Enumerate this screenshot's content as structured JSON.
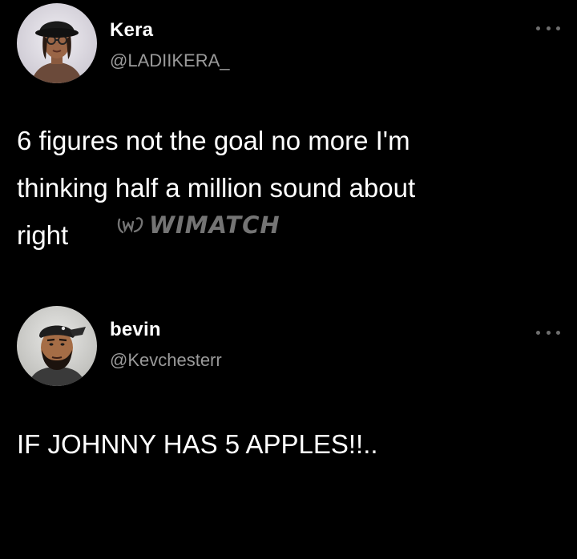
{
  "tweets": [
    {
      "display_name": "Kera",
      "handle": "@LADIIKERA_",
      "text": "6 figures not the goal no more I'm\nthinking half a million sound about\nright",
      "avatar_icon": "person-with-hat-avatar",
      "more_icon": "more-options-icon"
    },
    {
      "display_name": "bevin",
      "handle": "@Kevchesterr",
      "text": "IF JOHNNY HAS 5 APPLES!!..",
      "avatar_icon": "bearded-man-with-cap-avatar",
      "more_icon": "more-options-icon"
    }
  ],
  "watermark": {
    "text": "WIMATCH",
    "icon": "wimatch-logo-icon"
  },
  "colors": {
    "background": "#000000",
    "text": "#ffffff",
    "handle": "#9a9a9a",
    "watermark": "#8e8e8e"
  }
}
